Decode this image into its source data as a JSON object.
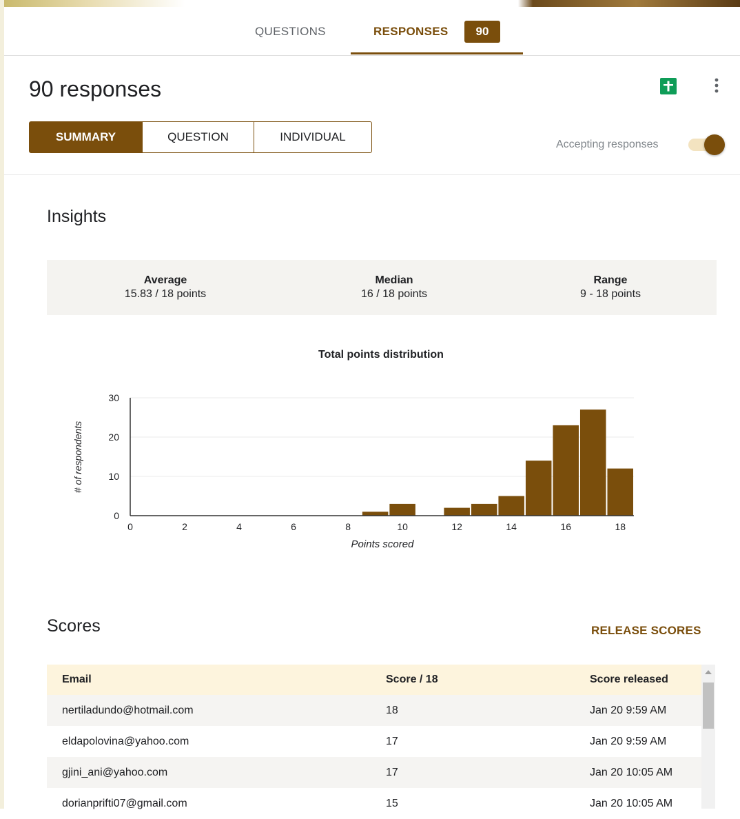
{
  "tabs": {
    "questions": "QUESTIONS",
    "responses": "RESPONSES",
    "responses_count": "90"
  },
  "header": {
    "title": "90 responses",
    "segments": {
      "summary": "SUMMARY",
      "question": "QUESTION",
      "individual": "INDIVIDUAL"
    },
    "accepting_label": "Accepting responses",
    "accepting": true
  },
  "insights": {
    "title": "Insights",
    "average": {
      "label": "Average",
      "value": "15.83 / 18 points"
    },
    "median": {
      "label": "Median",
      "value": "16 / 18 points"
    },
    "range": {
      "label": "Range",
      "value": "9 - 18 points"
    }
  },
  "chart_data": {
    "type": "bar",
    "title": "Total points distribution",
    "xlabel": "Points scored",
    "ylabel": "# of respondents",
    "xlim": [
      0,
      18.5
    ],
    "ylim": [
      0,
      30
    ],
    "x_ticks": [
      0,
      2,
      4,
      6,
      8,
      10,
      12,
      14,
      16,
      18
    ],
    "y_ticks": [
      0,
      10,
      20,
      30
    ],
    "x": [
      9,
      10,
      12,
      13,
      14,
      15,
      16,
      17,
      18
    ],
    "values": [
      1,
      3,
      2,
      3,
      5,
      14,
      23,
      27,
      12
    ],
    "color": "#7a4e0c",
    "grid": true
  },
  "scores": {
    "title": "Scores",
    "release_label": "RELEASE SCORES",
    "columns": [
      "Email",
      "Score / 18",
      "Score released"
    ],
    "rows": [
      {
        "email": "nertiladundo@hotmail.com",
        "score": "18",
        "released": "Jan 20 9:59 AM"
      },
      {
        "email": "eldapolovina@yahoo.com",
        "score": "17",
        "released": "Jan 20 9:59 AM"
      },
      {
        "email": "gjini_ani@yahoo.com",
        "score": "17",
        "released": "Jan 20 10:05 AM"
      },
      {
        "email": "dorianprifti07@gmail.com",
        "score": "15",
        "released": "Jan 20 10:05 AM"
      }
    ]
  },
  "colors": {
    "accent": "#7a4e0c",
    "sheets_green": "#0f9d58"
  },
  "icons": {
    "sheets": "sheets-icon",
    "more": "more-vert-icon"
  }
}
